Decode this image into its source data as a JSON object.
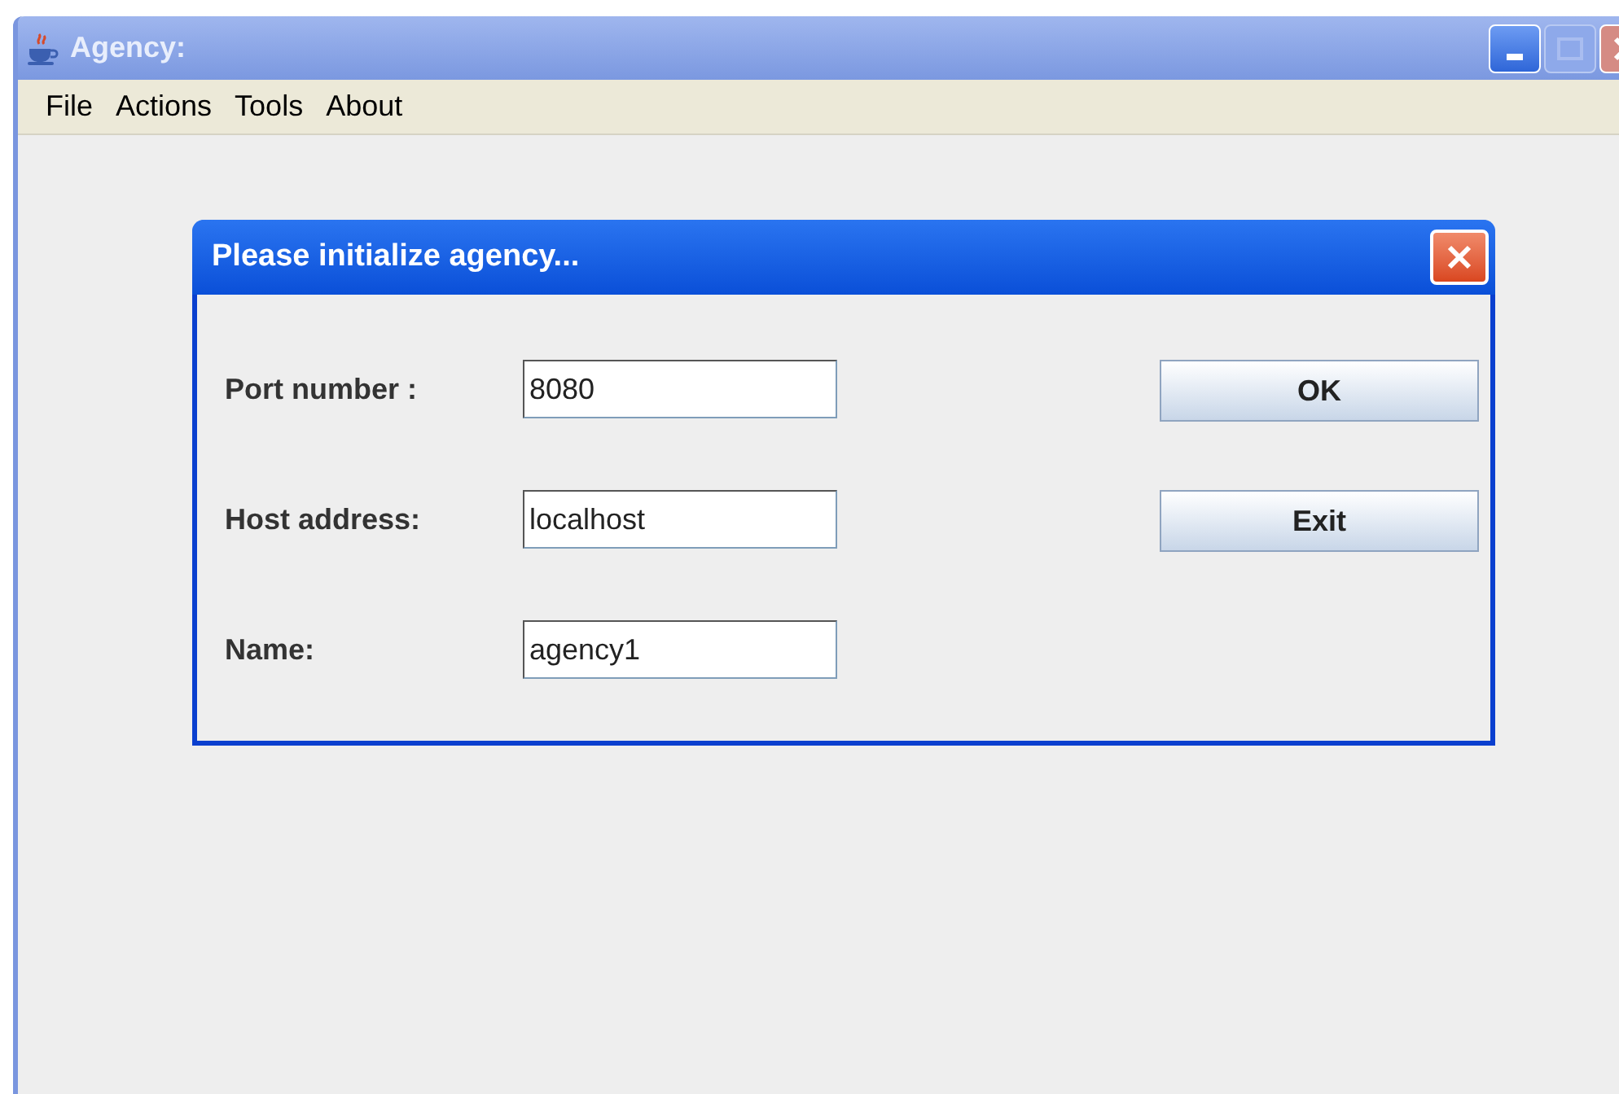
{
  "window": {
    "title": "Agency:"
  },
  "menu": [
    "File",
    "Actions",
    "Tools",
    "About"
  ],
  "dialog": {
    "title": "Please initialize agency...",
    "fields": [
      {
        "label": "Port number :",
        "value": "8080"
      },
      {
        "label": "Host address:",
        "value": "localhost"
      },
      {
        "label": "Name:",
        "value": "agency1"
      }
    ],
    "buttons": [
      "OK",
      "Exit"
    ]
  }
}
